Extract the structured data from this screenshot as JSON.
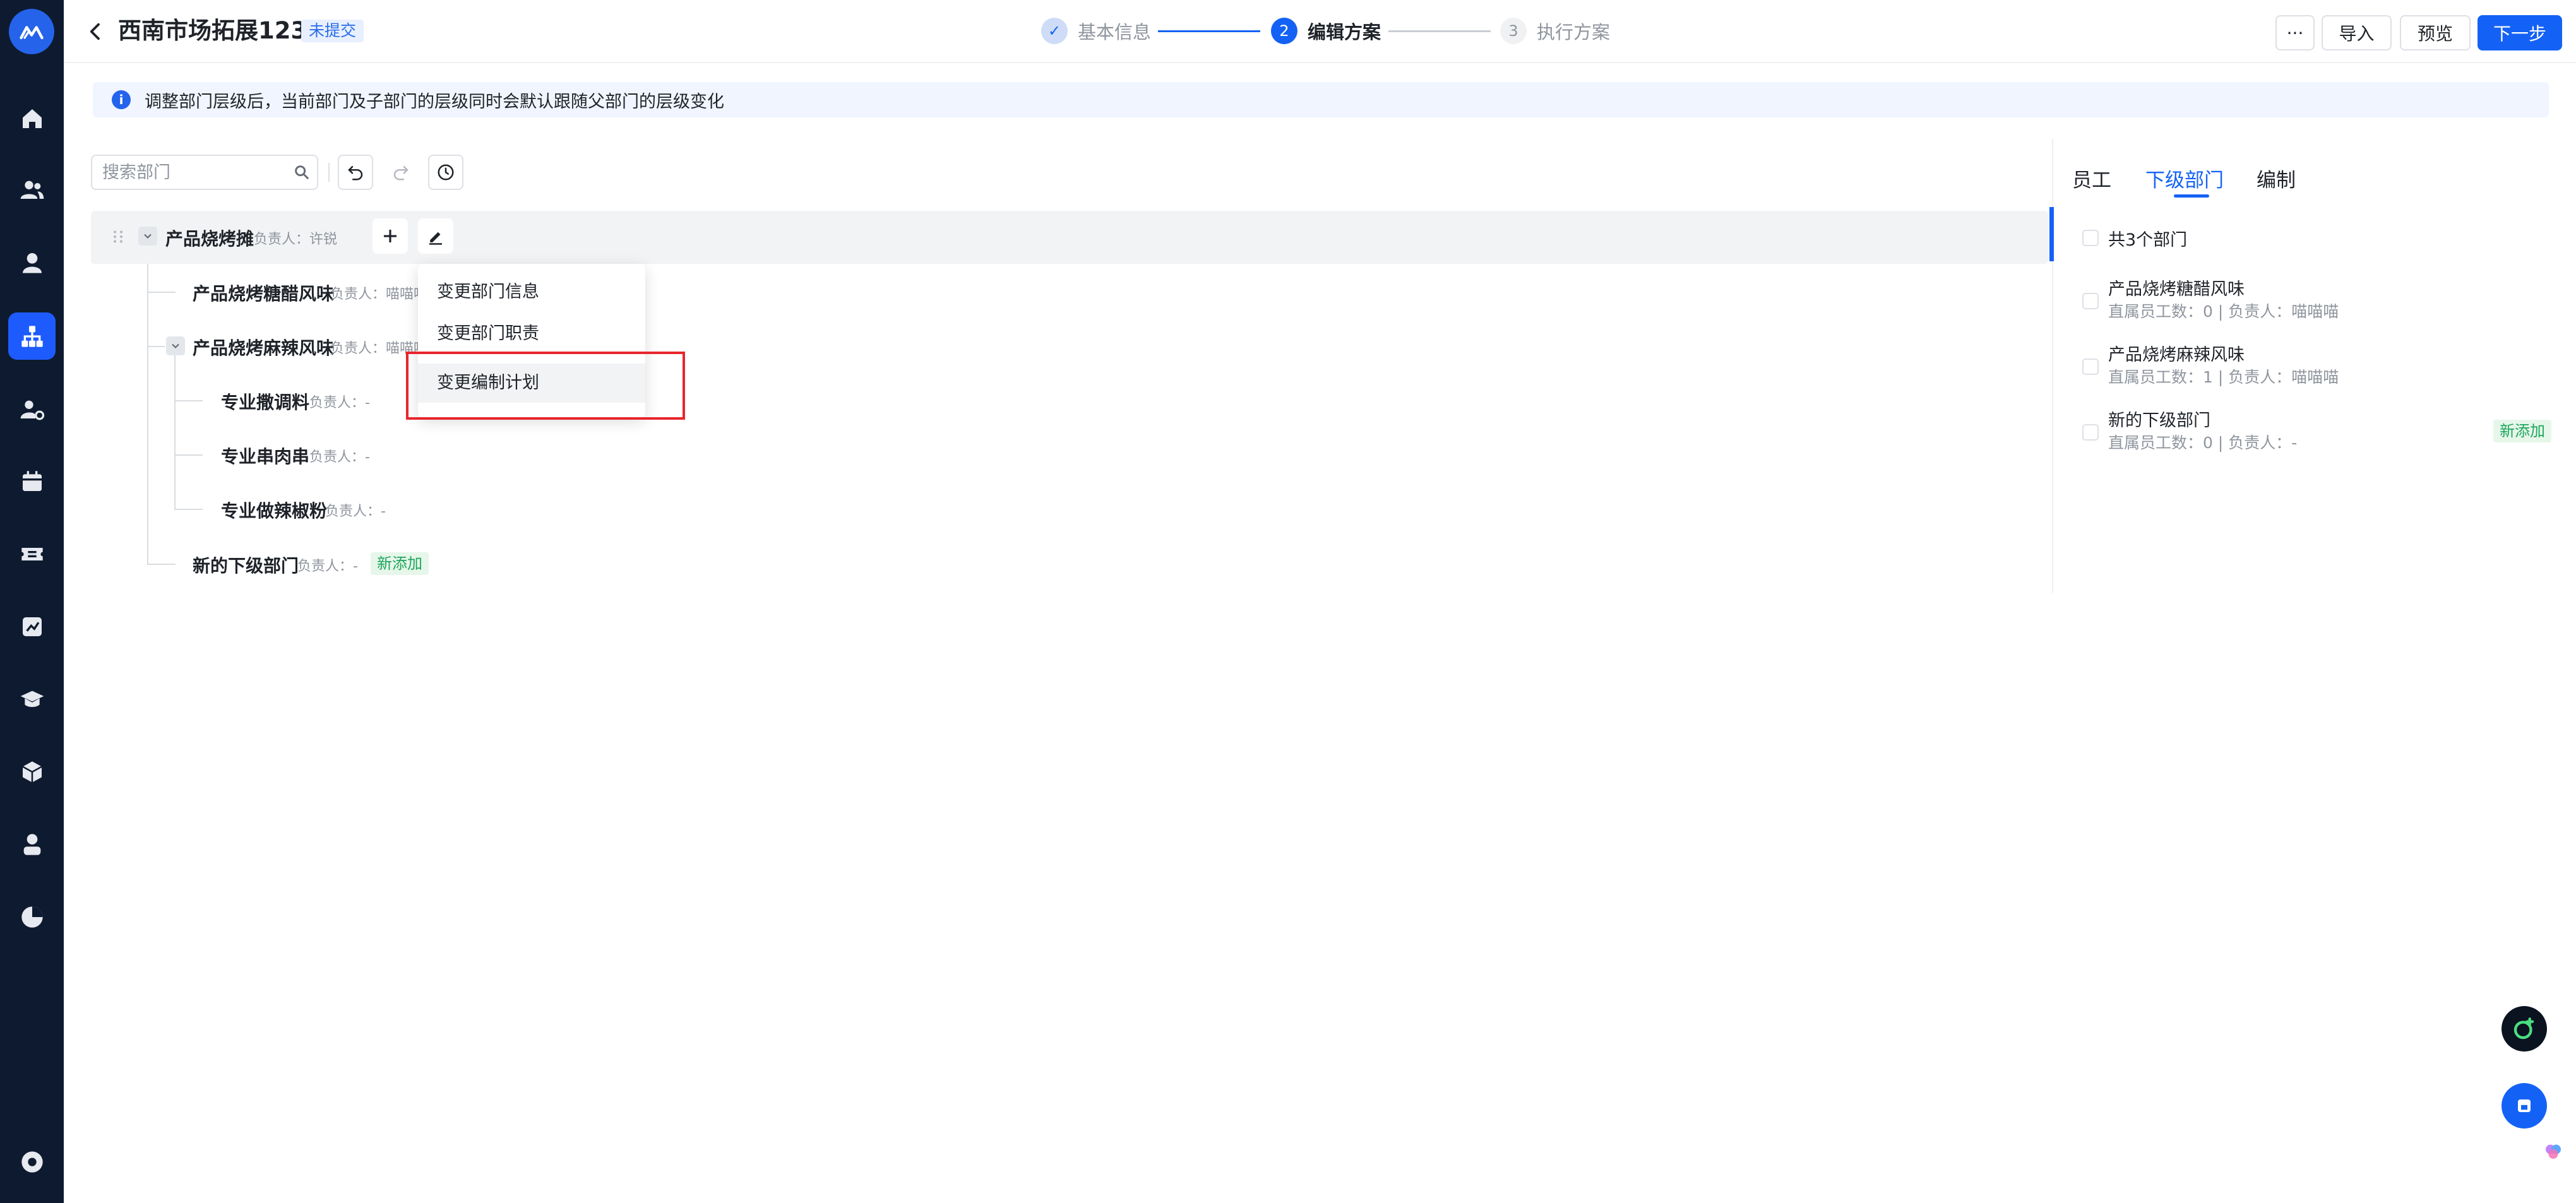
{
  "header": {
    "title": "西南市场拓展123",
    "status_tag": "未提交",
    "steps": [
      {
        "num": "✓",
        "label": "基本信息",
        "state": "done"
      },
      {
        "num": "2",
        "label": "编辑方案",
        "state": "active"
      },
      {
        "num": "3",
        "label": "执行方案",
        "state": "pending"
      }
    ],
    "more_label": "···",
    "import_label": "导入",
    "preview_label": "预览",
    "next_label": "下一步"
  },
  "notice": {
    "text": "调整部门层级后，当前部门及子部门的层级同时会默认跟随父部门的层级变化"
  },
  "toolbar": {
    "search_placeholder": "搜索部门"
  },
  "tree": {
    "root": {
      "name": "产品烧烤摊",
      "owner": "负责人：许锐"
    },
    "children": [
      {
        "name": "产品烧烤糖醋风味",
        "owner": "负责人：喵喵喵"
      },
      {
        "name": "产品烧烤麻辣风味",
        "owner": "负责人：喵喵喵"
      },
      {
        "name": "专业撒调料",
        "owner": "负责人：-"
      },
      {
        "name": "专业串肉串",
        "owner": "负责人：-"
      },
      {
        "name": "专业做辣椒粉",
        "owner": "负责人：-"
      },
      {
        "name": "新的下级部门",
        "owner": "负责人：-",
        "tag": "新添加"
      }
    ]
  },
  "dropdown": {
    "items": [
      "变更部门信息",
      "变更部门职责",
      "变更编制计划"
    ]
  },
  "right_panel": {
    "tabs": [
      "员工",
      "下级部门",
      "编制"
    ],
    "active_tab": "下级部门",
    "total": "共3个部门",
    "items": [
      {
        "name": "产品烧烤糖醋风味",
        "detail": "直属员工数：0 | 负责人：喵喵喵"
      },
      {
        "name": "产品烧烤麻辣风味",
        "detail": "直属员工数：1 | 负责人：喵喵喵"
      },
      {
        "name": "新的下级部门",
        "detail": "直属员工数：0 | 负责人：-",
        "tag": "新添加"
      }
    ]
  },
  "colors": {
    "accent": "#1462f5",
    "sidebar_bg": "#0e1a2f",
    "highlight": "#e8262d",
    "new_tag_text": "#1fa55c"
  },
  "icons": {
    "sidebar": [
      "home-icon",
      "team-icon",
      "user-icon",
      "org-chart-icon",
      "user-settings-icon",
      "calendar-icon",
      "ticket-icon",
      "report-icon",
      "education-icon",
      "cube-icon",
      "person-icon",
      "pie-chart-icon",
      "settings-icon"
    ]
  }
}
